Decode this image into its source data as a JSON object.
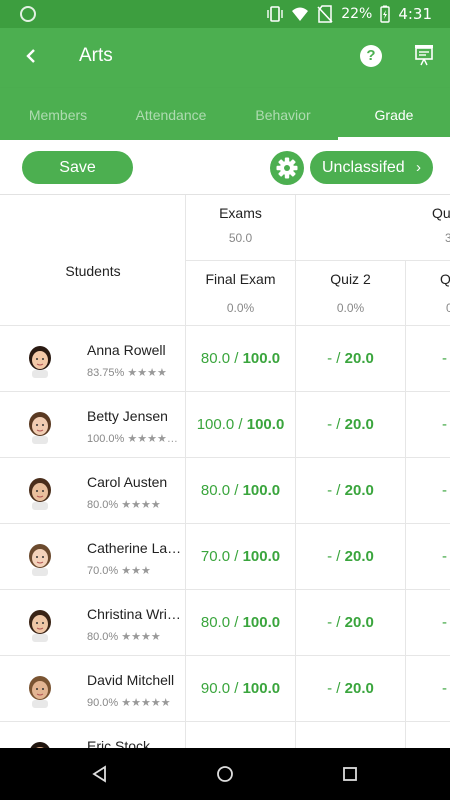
{
  "status": {
    "battery": "22%",
    "time": "4:31",
    "icons": [
      "vibrate-icon",
      "wifi-icon",
      "no-sim-icon",
      "battery-charging-icon"
    ]
  },
  "appbar": {
    "title": "Arts",
    "back_icon": "back-arrow-icon",
    "help_icon": "help-icon",
    "help_label": "?",
    "present_icon": "presentation-icon"
  },
  "tabs": [
    {
      "label": "Members",
      "active": false
    },
    {
      "label": "Attendance",
      "active": false
    },
    {
      "label": "Behavior",
      "active": false
    },
    {
      "label": "Grade",
      "active": true
    }
  ],
  "toolbar": {
    "save_label": "Save",
    "settings_icon": "gear-icon",
    "classify_label": "Unclassifed",
    "classify_chevron": "›"
  },
  "table": {
    "students_header": "Students",
    "groups": [
      {
        "name": "Exams",
        "weight": "50.0"
      },
      {
        "name": "Qu",
        "weight": "3"
      }
    ],
    "columns": [
      {
        "name": "Final Exam",
        "weight": "0.0%"
      },
      {
        "name": "Quiz 2",
        "weight": "0.0%"
      },
      {
        "name": "Q",
        "weight": "0"
      }
    ],
    "students": [
      {
        "name": "Anna Rowell",
        "percent": "83.75%",
        "stars": "★★★★",
        "grades": [
          {
            "score": "80.0",
            "max": "100.0"
          },
          {
            "score": "-",
            "max": "20.0"
          },
          {
            "score": "-",
            "max": ""
          }
        ]
      },
      {
        "name": "Betty Jensen",
        "percent": "100.0%",
        "stars": "★★★★…",
        "grades": [
          {
            "score": "100.0",
            "max": "100.0"
          },
          {
            "score": "-",
            "max": "20.0"
          },
          {
            "score": "-",
            "max": ""
          }
        ]
      },
      {
        "name": "Carol Austen",
        "percent": "80.0%",
        "stars": "★★★★",
        "grades": [
          {
            "score": "80.0",
            "max": "100.0"
          },
          {
            "score": "-",
            "max": "20.0"
          },
          {
            "score": "-",
            "max": ""
          }
        ]
      },
      {
        "name": "Catherine La…",
        "percent": "70.0%",
        "stars": "★★★",
        "grades": [
          {
            "score": "70.0",
            "max": "100.0"
          },
          {
            "score": "-",
            "max": "20.0"
          },
          {
            "score": "-",
            "max": ""
          }
        ]
      },
      {
        "name": "Christina Wri…",
        "percent": "80.0%",
        "stars": "★★★★",
        "grades": [
          {
            "score": "80.0",
            "max": "100.0"
          },
          {
            "score": "-",
            "max": "20.0"
          },
          {
            "score": "-",
            "max": ""
          }
        ]
      },
      {
        "name": "David Mitchell",
        "percent": "90.0%",
        "stars": "★★★★★",
        "grades": [
          {
            "score": "90.0",
            "max": "100.0"
          },
          {
            "score": "-",
            "max": "20.0"
          },
          {
            "score": "-",
            "max": ""
          }
        ]
      },
      {
        "name": "Eric Stock",
        "percent": "",
        "stars": "",
        "grades": [
          {
            "score": "",
            "max": ""
          },
          {
            "score": "",
            "max": ""
          },
          {
            "score": "",
            "max": ""
          }
        ]
      }
    ]
  },
  "navbar": {
    "icons": [
      "back-triangle-icon",
      "home-circle-icon",
      "recents-square-icon"
    ]
  },
  "colors": {
    "primary": "#4caf50",
    "status_bar": "#3d9e3f",
    "grade_text": "#3aa53d"
  }
}
